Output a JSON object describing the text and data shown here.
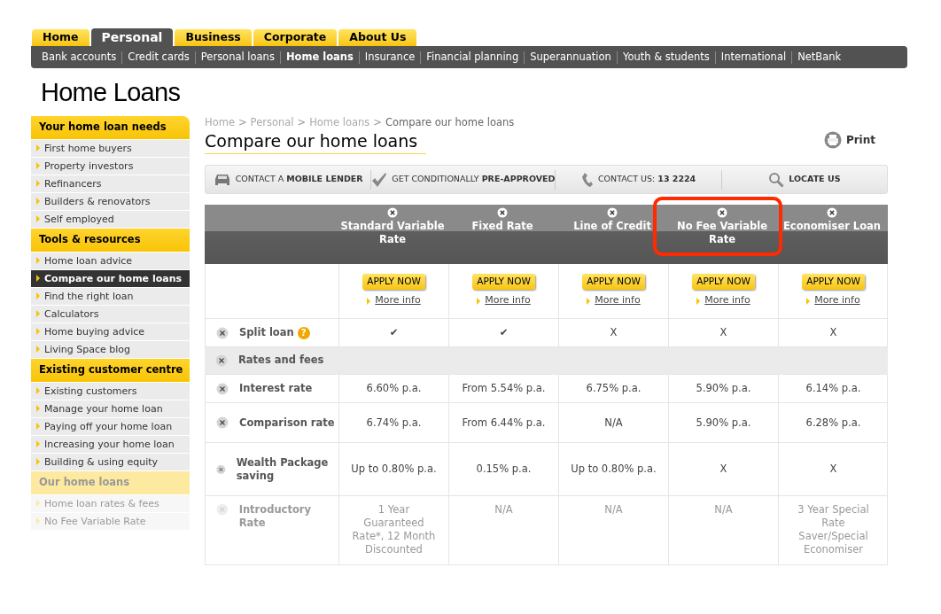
{
  "top_tabs": [
    {
      "label": "Home",
      "selected": false
    },
    {
      "label": "Personal",
      "selected": true
    },
    {
      "label": "Business",
      "selected": false
    },
    {
      "label": "Corporate",
      "selected": false
    },
    {
      "label": "About Us",
      "selected": false
    }
  ],
  "sub_nav": [
    {
      "label": "Bank accounts",
      "selected": false
    },
    {
      "label": "Credit cards",
      "selected": false
    },
    {
      "label": "Personal loans",
      "selected": false
    },
    {
      "label": "Home loans",
      "selected": true
    },
    {
      "label": "Insurance",
      "selected": false
    },
    {
      "label": "Financial planning",
      "selected": false
    },
    {
      "label": "Superannuation",
      "selected": false
    },
    {
      "label": "Youth & students",
      "selected": false
    },
    {
      "label": "International",
      "selected": false
    },
    {
      "label": "NetBank",
      "selected": false
    }
  ],
  "page_title": "Home Loans",
  "sidebar": {
    "sections": [
      {
        "title": "Your home loan needs",
        "faded": false,
        "items": [
          {
            "label": "First home buyers",
            "selected": false
          },
          {
            "label": "Property investors",
            "selected": false
          },
          {
            "label": "Refinancers",
            "selected": false
          },
          {
            "label": "Builders & renovators",
            "selected": false
          },
          {
            "label": "Self employed",
            "selected": false
          }
        ]
      },
      {
        "title": "Tools & resources",
        "faded": false,
        "items": [
          {
            "label": "Home loan advice",
            "selected": false
          },
          {
            "label": "Compare our home loans",
            "selected": true
          },
          {
            "label": "Find the right loan",
            "selected": false
          },
          {
            "label": "Calculators",
            "selected": false
          },
          {
            "label": "Home buying advice",
            "selected": false
          },
          {
            "label": "Living Space blog",
            "selected": false
          }
        ]
      },
      {
        "title": "Existing customer centre",
        "faded": false,
        "items": [
          {
            "label": "Existing customers",
            "selected": false
          },
          {
            "label": "Manage your home loan",
            "selected": false
          },
          {
            "label": "Paying off your home loan",
            "selected": false
          },
          {
            "label": "Increasing your home loan",
            "selected": false
          },
          {
            "label": "Building & using equity",
            "selected": false
          }
        ]
      },
      {
        "title": "Our home loans",
        "faded": true,
        "items": [
          {
            "label": "Home loan rates & fees",
            "selected": false
          },
          {
            "label": "No Fee Variable Rate",
            "selected": false
          }
        ]
      }
    ]
  },
  "breadcrumb": {
    "separator": ">",
    "items": [
      "Home",
      "Personal",
      "Home loans",
      "Compare our home loans"
    ]
  },
  "heading": "Compare our home loans",
  "print": "Print",
  "toolbar": [
    {
      "kind": "car",
      "text": "CONTACT A **MOBILE LENDER**"
    },
    {
      "kind": "tick",
      "text": "GET CONDITIONALLY **PRE-APPROVED**"
    },
    {
      "kind": "phone",
      "text": "CONTACT US: **13 2224**"
    },
    {
      "kind": "search",
      "text": "**LOCATE US**"
    }
  ],
  "table": {
    "columns": [
      {
        "title": "Standard Variable Rate",
        "highlighted": false,
        "apply_label": "APPLY NOW",
        "more_info": "More info"
      },
      {
        "title": "Fixed Rate",
        "highlighted": false,
        "apply_label": "APPLY NOW",
        "more_info": "More info"
      },
      {
        "title": "Line of Credit",
        "highlighted": false,
        "apply_label": "APPLY NOW",
        "more_info": "More info"
      },
      {
        "title": "No Fee Variable Rate",
        "highlighted": true,
        "apply_label": "APPLY NOW",
        "more_info": "More info"
      },
      {
        "title": "Economiser Loan",
        "highlighted": false,
        "apply_label": "APPLY NOW",
        "more_info": "More info"
      }
    ],
    "rows": [
      {
        "kind": "row",
        "label": "Split loan",
        "help": "?",
        "faded": false,
        "cells": [
          "✔",
          "✔",
          "X",
          "X",
          "X"
        ]
      },
      {
        "kind": "group",
        "label": "Rates and fees"
      },
      {
        "kind": "row",
        "label": "Interest rate",
        "faded": false,
        "cells": [
          "6.60% p.a.",
          "From 5.54% p.a.",
          "6.75% p.a.",
          "5.90% p.a.",
          "6.14% p.a."
        ]
      },
      {
        "kind": "row",
        "label": "Comparison rate",
        "faded": false,
        "cells": [
          "6.74% p.a.",
          "From 6.44% p.a.",
          "N/A",
          "5.90% p.a.",
          "6.28% p.a."
        ]
      },
      {
        "kind": "row",
        "label": "Wealth Package saving",
        "faded": false,
        "cells": [
          "Up to 0.80% p.a.",
          "0.15% p.a.",
          "Up to 0.80% p.a.",
          "X",
          "X"
        ]
      },
      {
        "kind": "row",
        "label": "Introductory Rate",
        "faded": true,
        "cells": [
          "1 Year Guaranteed Rate*, 12 Month Discounted",
          "N/A",
          "N/A",
          "N/A",
          "3 Year Special Rate Saver/Special Economiser"
        ]
      }
    ]
  }
}
